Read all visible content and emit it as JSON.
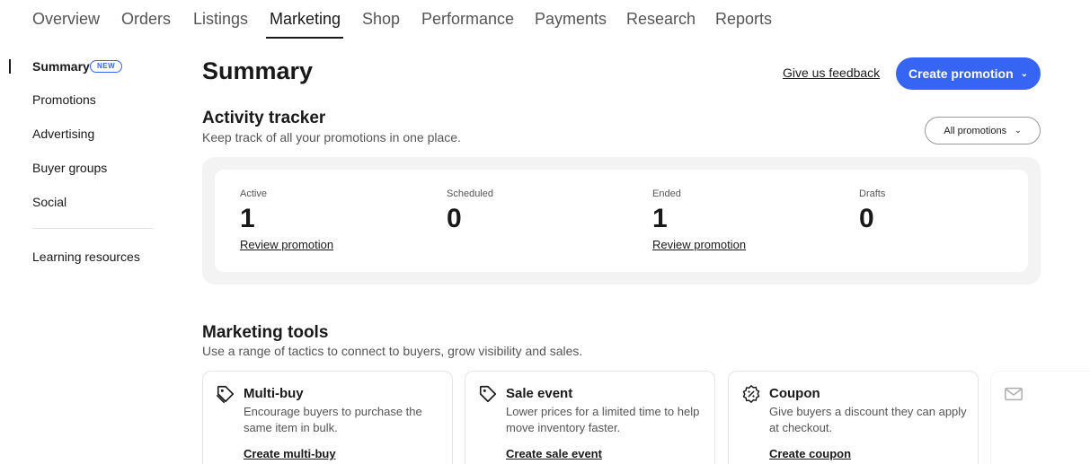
{
  "topnav": {
    "tabs": [
      "Overview",
      "Orders",
      "Listings",
      "Marketing",
      "Shop",
      "Performance",
      "Payments",
      "Research",
      "Reports"
    ],
    "active": "Marketing"
  },
  "sidebar": {
    "items": [
      "Summary",
      "Promotions",
      "Advertising",
      "Buyer groups",
      "Social",
      "Learning resources"
    ],
    "badge": "NEW"
  },
  "header": {
    "title": "Summary",
    "feedback_label": "Give us feedback",
    "create_label": "Create promotion"
  },
  "activity": {
    "title": "Activity tracker",
    "subtitle": "Keep track of all your promotions in one place.",
    "filter_label": "All promotions",
    "stats": [
      {
        "label": "Active",
        "value": "1",
        "link": "Review promotion"
      },
      {
        "label": "Scheduled",
        "value": "0",
        "link": ""
      },
      {
        "label": "Ended",
        "value": "1",
        "link": "Review promotion"
      },
      {
        "label": "Drafts",
        "value": "0",
        "link": ""
      }
    ]
  },
  "tools": {
    "title": "Marketing tools",
    "subtitle": "Use a range of tactics to connect to buyers, grow visibility and sales.",
    "cards": [
      {
        "icon": "tag-multi-icon",
        "title": "Multi-buy",
        "desc": "Encourage buyers to purchase the same item in bulk.",
        "link": "Create multi-buy"
      },
      {
        "icon": "tag-icon",
        "title": "Sale event",
        "desc": "Lower prices for a limited time to help move inventory faster.",
        "link": "Create sale event"
      },
      {
        "icon": "coupon-badge-icon",
        "title": "Coupon",
        "desc": "Give buyers a discount they can apply at checkout.",
        "link": "Create coupon"
      },
      {
        "icon": "mail-icon"
      }
    ]
  },
  "colors": {
    "accent": "#3665f3",
    "text": "#191919",
    "muted": "#555555",
    "panel": "#f3f3f3"
  }
}
